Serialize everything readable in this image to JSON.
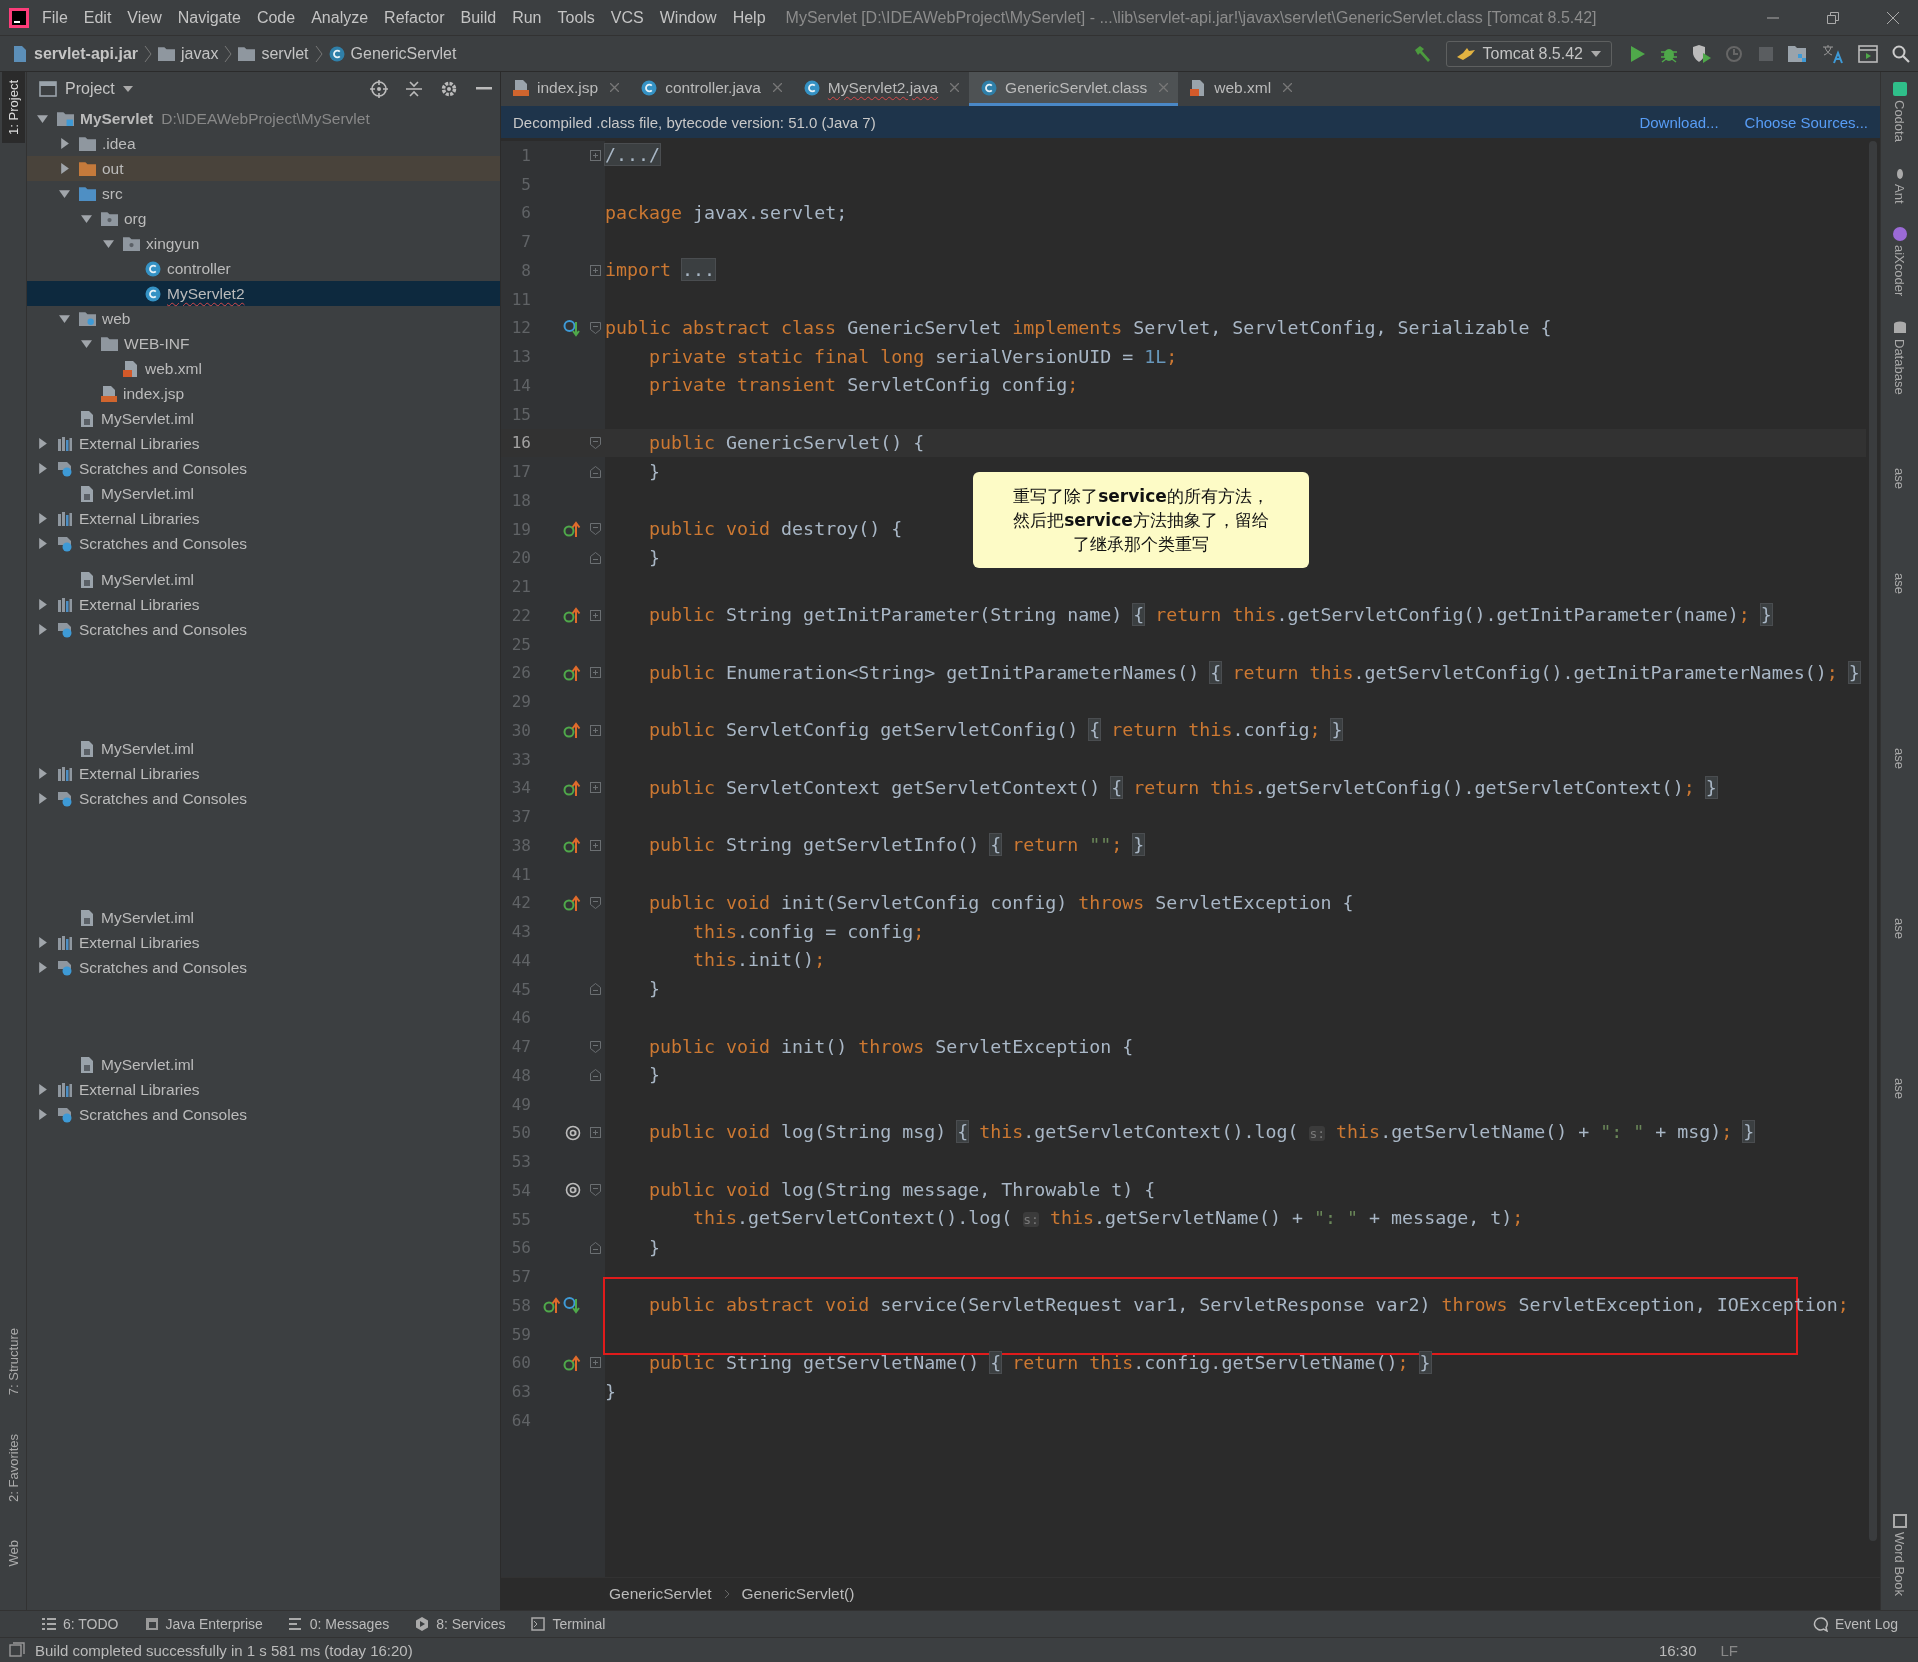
{
  "window": {
    "title": "MyServlet [D:\\IDEAWebProject\\MyServlet] - ...\\lib\\servlet-api.jar!\\javax\\servlet\\GenericServlet.class [Tomcat 8.5.42]"
  },
  "menu_bar": [
    "File",
    "Edit",
    "View",
    "Navigate",
    "Code",
    "Analyze",
    "Refactor",
    "Build",
    "Run",
    "Tools",
    "VCS",
    "Window",
    "Help"
  ],
  "navigation_bar": {
    "breadcrumbs": [
      {
        "label": "servlet-api.jar",
        "kind": "jar"
      },
      {
        "label": "javax",
        "kind": "folder"
      },
      {
        "label": "servlet",
        "kind": "folder"
      },
      {
        "label": "GenericServlet",
        "kind": "classfile"
      }
    ],
    "run_configuration": "Tomcat 8.5.42"
  },
  "left_stripe": [
    {
      "label": "1: Project",
      "selected": true
    },
    {
      "label": "7: Structure",
      "selected": false
    },
    {
      "label": "2: Favorites",
      "selected": false
    },
    {
      "label": "Web",
      "selected": false
    }
  ],
  "project_panel": {
    "title": "Project",
    "tree": [
      {
        "label": "MyServlet",
        "path": "D:\\IDEAWebProject\\MyServlet",
        "kind": "module",
        "expanded": true,
        "selected": false,
        "excluded": false,
        "error": false,
        "children": [
          {
            "label": ".idea",
            "kind": "folder",
            "expanded": false,
            "selected": false,
            "excluded": false,
            "error": false
          },
          {
            "label": "out",
            "kind": "excluded",
            "expanded": false,
            "selected": false,
            "excluded": true,
            "error": false
          },
          {
            "label": "src",
            "kind": "source",
            "expanded": true,
            "selected": false,
            "excluded": false,
            "error": false,
            "children": [
              {
                "label": "org",
                "kind": "package",
                "expanded": true,
                "selected": false,
                "excluded": false,
                "error": false,
                "children": [
                  {
                    "label": "xingyun",
                    "kind": "package",
                    "expanded": true,
                    "selected": false,
                    "excluded": false,
                    "error": false,
                    "children": [
                      {
                        "label": "controller",
                        "kind": "class",
                        "selected": false,
                        "excluded": false,
                        "error": false
                      },
                      {
                        "label": "MyServlet2",
                        "kind": "class",
                        "selected": true,
                        "excluded": false,
                        "error": true
                      }
                    ]
                  }
                ]
              }
            ]
          },
          {
            "label": "web",
            "kind": "web",
            "expanded": true,
            "selected": false,
            "excluded": false,
            "error": false,
            "children": [
              {
                "label": "WEB-INF",
                "kind": "folder",
                "expanded": true,
                "selected": false,
                "excluded": false,
                "error": false,
                "children": [
                  {
                    "label": "web.xml",
                    "kind": "xml",
                    "selected": false,
                    "excluded": false,
                    "error": false
                  }
                ]
              },
              {
                "label": "index.jsp",
                "kind": "jsp",
                "selected": false,
                "excluded": false,
                "error": false
              }
            ]
          },
          {
            "label": "MyServlet.iml",
            "kind": "iml",
            "selected": false,
            "excluded": false,
            "error": false
          }
        ]
      },
      {
        "label": "External Libraries",
        "kind": "library",
        "expanded": false,
        "selected": false,
        "excluded": false,
        "error": false
      },
      {
        "label": "Scratches and Consoles",
        "kind": "scratch",
        "expanded": false,
        "selected": false,
        "excluded": false,
        "error": false
      }
    ],
    "repeated_rows": [
      [
        {
          "label": "MyServlet.iml",
          "kind": "iml"
        },
        {
          "label": "External Libraries",
          "kind": "library",
          "expanded": false
        },
        {
          "label": "Scratches and Consoles",
          "kind": "scratch",
          "expanded": false
        }
      ],
      [
        {
          "label": "MyServlet.iml",
          "kind": "iml"
        },
        {
          "label": "External Libraries",
          "kind": "library",
          "expanded": false
        },
        {
          "label": "Scratches and Consoles",
          "kind": "scratch",
          "expanded": false
        }
      ],
      [
        {
          "label": "MyServlet.iml",
          "kind": "iml"
        },
        {
          "label": "External Libraries",
          "kind": "library",
          "expanded": false
        },
        {
          "label": "Scratches and Consoles",
          "kind": "scratch",
          "expanded": false
        }
      ],
      [
        {
          "label": "MyServlet.iml",
          "kind": "iml"
        },
        {
          "label": "External Libraries",
          "kind": "library",
          "expanded": false
        },
        {
          "label": "Scratches and Consoles",
          "kind": "scratch",
          "expanded": false
        }
      ],
      [
        {
          "label": "MyServlet.iml",
          "kind": "iml"
        },
        {
          "label": "External Libraries",
          "kind": "library",
          "expanded": false
        },
        {
          "label": "Scratches and Consoles",
          "kind": "scratch",
          "expanded": false
        }
      ]
    ]
  },
  "editor_tabs": [
    {
      "label": "index.jsp",
      "kind": "jsp",
      "selected": false,
      "error": false
    },
    {
      "label": "controller.java",
      "kind": "class",
      "selected": false,
      "error": false
    },
    {
      "label": "MyServlet2.java",
      "kind": "class",
      "selected": false,
      "error": true
    },
    {
      "label": "GenericServlet.class",
      "kind": "classfile",
      "selected": true,
      "error": false
    },
    {
      "label": "web.xml",
      "kind": "xml",
      "selected": false,
      "error": false
    }
  ],
  "notification": {
    "text": "Decompiled .class file, bytecode version: 51.0 (Java 7)",
    "links": [
      "Download...",
      "Choose Sources..."
    ]
  },
  "code_lines": [
    {
      "line_number": "1",
      "tokens": [
        {
          "kind": "folded",
          "text": "/.../"
        }
      ]
    },
    {
      "line_number": "5"
    },
    {
      "line_number": "6",
      "tokens": [
        {
          "kind": "keyword",
          "text": "package "
        },
        {
          "kind": "plain",
          "text": "javax.servlet;"
        }
      ]
    },
    {
      "line_number": "7"
    },
    {
      "line_number": "8",
      "tokens": [
        {
          "kind": "keyword",
          "text": "import "
        },
        {
          "kind": "folded",
          "text": "..."
        }
      ]
    },
    {
      "line_number": "11"
    },
    {
      "line_number": "12",
      "kind": "implemented",
      "tokens": [
        {
          "kind": "keyword",
          "text": "public abstract class "
        },
        {
          "kind": "plain",
          "text": "GenericServlet "
        },
        {
          "kind": "keyword",
          "text": "implements "
        },
        {
          "kind": "plain",
          "text": "Servlet, ServletConfig, Serializable {"
        }
      ]
    },
    {
      "line_number": "13",
      "tokens": [
        {
          "kind": "keyword",
          "text": "    private static final long "
        },
        {
          "kind": "plain",
          "text": "serialVersionUID = "
        },
        {
          "kind": "number",
          "text": "1L"
        },
        {
          "kind": "keyword",
          "text": ";"
        }
      ]
    },
    {
      "line_number": "14",
      "tokens": [
        {
          "kind": "keyword",
          "text": "    private transient "
        },
        {
          "kind": "plain",
          "text": "ServletConfig config"
        },
        {
          "kind": "keyword",
          "text": ";"
        }
      ]
    },
    {
      "line_number": "15"
    },
    {
      "line_number": "16",
      "current": true,
      "tokens": [
        {
          "kind": "keyword",
          "text": "    public "
        },
        {
          "kind": "plain",
          "text": "GenericServlet() {"
        }
      ]
    },
    {
      "line_number": "17",
      "tokens": [
        {
          "kind": "plain",
          "text": "    }"
        }
      ]
    },
    {
      "line_number": "18"
    },
    {
      "line_number": "19",
      "kind": "implements",
      "tokens": [
        {
          "kind": "keyword",
          "text": "    public void "
        },
        {
          "kind": "plain",
          "text": "destroy() {"
        }
      ]
    },
    {
      "line_number": "20",
      "tokens": [
        {
          "kind": "plain",
          "text": "    }"
        }
      ]
    },
    {
      "line_number": "21"
    },
    {
      "line_number": "22",
      "kind": "implements",
      "tokens": [
        {
          "kind": "keyword",
          "text": "    public "
        },
        {
          "kind": "plain",
          "text": "String getInitParameter(String name) "
        },
        {
          "kind": "folded",
          "text": "{"
        },
        {
          "kind": "keyword",
          "text": " return this"
        },
        {
          "kind": "plain",
          "text": ".getServletConfig().getInitParameter(name)"
        },
        {
          "kind": "keyword",
          "text": "; "
        },
        {
          "kind": "folded",
          "text": "}"
        }
      ]
    },
    {
      "line_number": "25"
    },
    {
      "line_number": "26",
      "kind": "implements",
      "tokens": [
        {
          "kind": "keyword",
          "text": "    public "
        },
        {
          "kind": "plain",
          "text": "Enumeration<String> getInitParameterNames() "
        },
        {
          "kind": "folded",
          "text": "{"
        },
        {
          "kind": "keyword",
          "text": " return this"
        },
        {
          "kind": "plain",
          "text": ".getServletConfig().getInitParameterNames()"
        },
        {
          "kind": "keyword",
          "text": "; "
        },
        {
          "kind": "folded",
          "text": "}"
        }
      ]
    },
    {
      "line_number": "29"
    },
    {
      "line_number": "30",
      "kind": "implements",
      "tokens": [
        {
          "kind": "keyword",
          "text": "    public "
        },
        {
          "kind": "plain",
          "text": "ServletConfig getServletConfig() "
        },
        {
          "kind": "folded",
          "text": "{"
        },
        {
          "kind": "keyword",
          "text": " return this"
        },
        {
          "kind": "plain",
          "text": ".config"
        },
        {
          "kind": "keyword",
          "text": "; "
        },
        {
          "kind": "folded",
          "text": "}"
        }
      ]
    },
    {
      "line_number": "33"
    },
    {
      "line_number": "34",
      "kind": "implements",
      "tokens": [
        {
          "kind": "keyword",
          "text": "    public "
        },
        {
          "kind": "plain",
          "text": "ServletContext getServletContext() "
        },
        {
          "kind": "folded",
          "text": "{"
        },
        {
          "kind": "keyword",
          "text": " return this"
        },
        {
          "kind": "plain",
          "text": ".getServletConfig().getServletContext()"
        },
        {
          "kind": "keyword",
          "text": "; "
        },
        {
          "kind": "folded",
          "text": "}"
        }
      ]
    },
    {
      "line_number": "37"
    },
    {
      "line_number": "38",
      "kind": "implements",
      "tokens": [
        {
          "kind": "keyword",
          "text": "    public "
        },
        {
          "kind": "plain",
          "text": "String getServletInfo() "
        },
        {
          "kind": "folded",
          "text": "{"
        },
        {
          "kind": "keyword",
          "text": " return "
        },
        {
          "kind": "string",
          "text": "\"\""
        },
        {
          "kind": "keyword",
          "text": "; "
        },
        {
          "kind": "folded",
          "text": "}"
        }
      ]
    },
    {
      "line_number": "41"
    },
    {
      "line_number": "42",
      "kind": "implements",
      "tokens": [
        {
          "kind": "keyword",
          "text": "    public void "
        },
        {
          "kind": "plain",
          "text": "init(ServletConfig config) "
        },
        {
          "kind": "keyword",
          "text": "throws "
        },
        {
          "kind": "plain",
          "text": "ServletException {"
        }
      ]
    },
    {
      "line_number": "43",
      "tokens": [
        {
          "kind": "keyword",
          "text": "        this"
        },
        {
          "kind": "plain",
          "text": ".config = config"
        },
        {
          "kind": "keyword",
          "text": ";"
        }
      ]
    },
    {
      "line_number": "44",
      "tokens": [
        {
          "kind": "keyword",
          "text": "        this"
        },
        {
          "kind": "plain",
          "text": ".init()"
        },
        {
          "kind": "keyword",
          "text": ";"
        }
      ]
    },
    {
      "line_number": "45",
      "tokens": [
        {
          "kind": "plain",
          "text": "    }"
        }
      ]
    },
    {
      "line_number": "46"
    },
    {
      "line_number": "47",
      "tokens": [
        {
          "kind": "keyword",
          "text": "    public void "
        },
        {
          "kind": "plain",
          "text": "init() "
        },
        {
          "kind": "keyword",
          "text": "throws "
        },
        {
          "kind": "plain",
          "text": "ServletException {"
        }
      ]
    },
    {
      "line_number": "48",
      "tokens": [
        {
          "kind": "plain",
          "text": "    }"
        }
      ]
    },
    {
      "line_number": "49"
    },
    {
      "line_number": "50",
      "kind": "annotation",
      "tokens": [
        {
          "kind": "keyword",
          "text": "    public void "
        },
        {
          "kind": "plain",
          "text": "log(String msg) "
        },
        {
          "kind": "folded",
          "text": "{"
        },
        {
          "kind": "keyword",
          "text": " this"
        },
        {
          "kind": "plain",
          "text": ".getServletContext().log( "
        },
        {
          "kind": "hint",
          "text": "s:"
        },
        {
          "kind": "keyword",
          "text": " this"
        },
        {
          "kind": "plain",
          "text": ".getServletName() + "
        },
        {
          "kind": "string",
          "text": "\": \""
        },
        {
          "kind": "plain",
          "text": " + msg)"
        },
        {
          "kind": "keyword",
          "text": "; "
        },
        {
          "kind": "folded",
          "text": "}"
        }
      ]
    },
    {
      "line_number": "53"
    },
    {
      "line_number": "54",
      "kind": "annotation",
      "tokens": [
        {
          "kind": "keyword",
          "text": "    public void "
        },
        {
          "kind": "plain",
          "text": "log(String message, Throwable t) {"
        }
      ]
    },
    {
      "line_number": "55",
      "tokens": [
        {
          "kind": "keyword",
          "text": "        this"
        },
        {
          "kind": "plain",
          "text": ".getServletContext().log( "
        },
        {
          "kind": "hint",
          "text": "s:"
        },
        {
          "kind": "keyword",
          "text": " this"
        },
        {
          "kind": "plain",
          "text": ".getServletName() + "
        },
        {
          "kind": "string",
          "text": "\": \""
        },
        {
          "kind": "plain",
          "text": " + message, t)"
        },
        {
          "kind": "keyword",
          "text": ";"
        }
      ]
    },
    {
      "line_number": "56",
      "tokens": [
        {
          "kind": "plain",
          "text": "    }"
        }
      ]
    },
    {
      "line_number": "57"
    },
    {
      "line_number": "58",
      "kind": "both",
      "boxed": true,
      "tokens": [
        {
          "kind": "keyword",
          "text": "    public abstract void "
        },
        {
          "kind": "plain",
          "text": "service(ServletRequest var1, ServletResponse var2) "
        },
        {
          "kind": "keyword",
          "text": "throws "
        },
        {
          "kind": "plain",
          "text": "ServletException, IOException"
        },
        {
          "kind": "keyword",
          "text": ";"
        }
      ]
    },
    {
      "line_number": "59",
      "boxed": true
    },
    {
      "line_number": "60",
      "kind": "implements",
      "tokens": [
        {
          "kind": "keyword",
          "text": "    public "
        },
        {
          "kind": "plain",
          "text": "String getServletName() "
        },
        {
          "kind": "folded",
          "text": "{"
        },
        {
          "kind": "keyword",
          "text": " return this"
        },
        {
          "kind": "plain",
          "text": ".config.getServletName()"
        },
        {
          "kind": "keyword",
          "text": "; "
        },
        {
          "kind": "folded",
          "text": "}"
        }
      ]
    },
    {
      "line_number": "63",
      "tokens": [
        {
          "kind": "plain",
          "text": "}"
        }
      ]
    },
    {
      "line_number": "64"
    }
  ],
  "note": {
    "lines": [
      "重写了除了**service**的所有方法，",
      "然后把**service**方法抽象了，留给",
      "了继承那个类重写"
    ]
  },
  "editor_breadcrumbs": [
    "GenericServlet",
    "GenericServlet()"
  ],
  "right_stripe": [
    {
      "label": "Codota",
      "kind": "codota"
    },
    {
      "label": "Ant",
      "kind": "ant"
    },
    {
      "label": "aiXcoder",
      "kind": "aix"
    },
    {
      "label": "Database",
      "kind": "database"
    },
    {
      "label": "ase"
    },
    {
      "label": "ase"
    },
    {
      "label": "ase"
    },
    {
      "label": "ase"
    },
    {
      "label": "ase"
    },
    {
      "label": "Word Book",
      "kind": "book"
    }
  ],
  "tool_windows": [
    {
      "label": "6: TODO",
      "kind": "list"
    },
    {
      "label": "Java Enterprise",
      "kind": "je"
    },
    {
      "label": "0: Messages",
      "kind": "messages"
    },
    {
      "label": "8: Services",
      "kind": "services"
    },
    {
      "label": "Terminal",
      "kind": "terminal"
    }
  ],
  "event_log": "Event Log",
  "status_bar": {
    "message": "Build completed successfully in 1 s 581 ms (today 16:20)",
    "position": "16:30",
    "line_separator": "LF"
  }
}
